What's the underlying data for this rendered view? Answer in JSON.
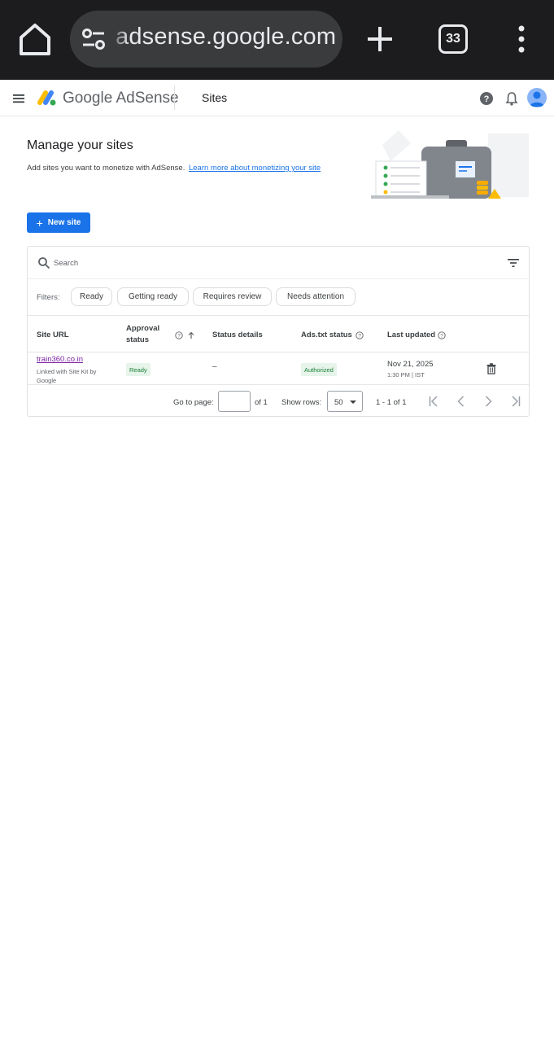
{
  "browser": {
    "url": "adsense.google.com",
    "tab_count": "33"
  },
  "header": {
    "brand": "Google AdSense",
    "section": "Sites"
  },
  "hero": {
    "title": "Manage your sites",
    "subtitle": "Add sites you want to monetize with AdSense.",
    "learn_link": "Learn more about monetizing your site"
  },
  "actions": {
    "new_site": "New site"
  },
  "search": {
    "placeholder": "Search"
  },
  "filters": {
    "label": "Filters:",
    "chips": [
      "Ready",
      "Getting ready",
      "Requires review",
      "Needs attention"
    ]
  },
  "table": {
    "columns": {
      "site_url": "Site URL",
      "approval": "Approval status",
      "status_details": "Status details",
      "ads_txt": "Ads.txt status",
      "last_updated": "Last updated"
    },
    "rows": [
      {
        "site": "train360.co.in",
        "note": "Linked with Site Kit by Google",
        "approval": "Ready",
        "details": "–",
        "ads_txt": "Authorized",
        "date": "Nov 21, 2025",
        "time": "1:30 PM | IST"
      }
    ]
  },
  "pagination": {
    "go_to_label": "Go to page:",
    "page_value": "",
    "of_pages": "of 1",
    "show_rows_label": "Show rows:",
    "rows_value": "50",
    "range": "1 - 1 of 1"
  },
  "colors": {
    "accent": "#1a73e8",
    "status_green": "#188038",
    "status_bg": "#e6f4ea",
    "link_visited": "#7b1fa2"
  },
  "icons": [
    "home-icon",
    "site-settings-icon",
    "plus-icon",
    "tab-switcher-icon",
    "more-vert-icon",
    "menu-icon",
    "adsense-logo-icon",
    "help-icon",
    "notifications-icon",
    "account-icon",
    "search-icon",
    "filter-icon",
    "trash-icon",
    "first-page-icon",
    "prev-page-icon",
    "next-page-icon",
    "last-page-icon"
  ]
}
